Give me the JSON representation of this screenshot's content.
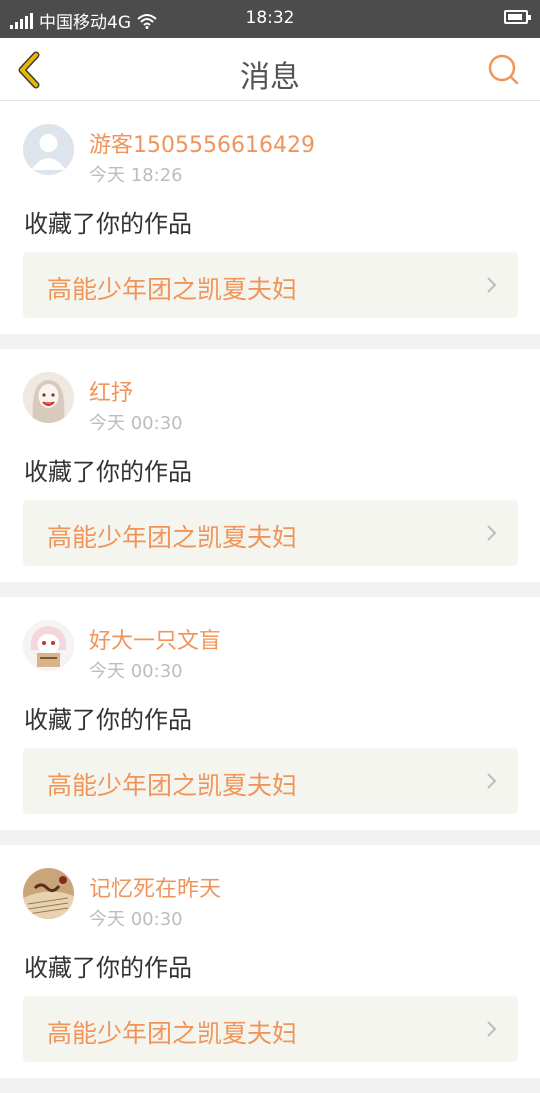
{
  "status_bar": {
    "carrier": "中国移动4G",
    "time": "18:32"
  },
  "header": {
    "title": "消息",
    "back_icon": "chevron-left-icon",
    "search_icon": "search-icon"
  },
  "colors": {
    "accent": "#f0955a",
    "back_icon": "#e6b800",
    "status_bar": "#4c4c4c"
  },
  "messages": [
    {
      "user": "游客1505556616429",
      "time": "今天 18:26",
      "action": "收藏了你的作品",
      "work": "高能少年团之凯夏夫妇"
    },
    {
      "user": "红抒",
      "time": "今天 00:30",
      "action": "收藏了你的作品",
      "work": "高能少年团之凯夏夫妇"
    },
    {
      "user": "好大一只文盲",
      "time": "今天 00:30",
      "action": "收藏了你的作品",
      "work": "高能少年团之凯夏夫妇"
    },
    {
      "user": "记忆死在昨天",
      "time": "今天 00:30",
      "action": "收藏了你的作品",
      "work": "高能少年团之凯夏夫妇"
    }
  ]
}
